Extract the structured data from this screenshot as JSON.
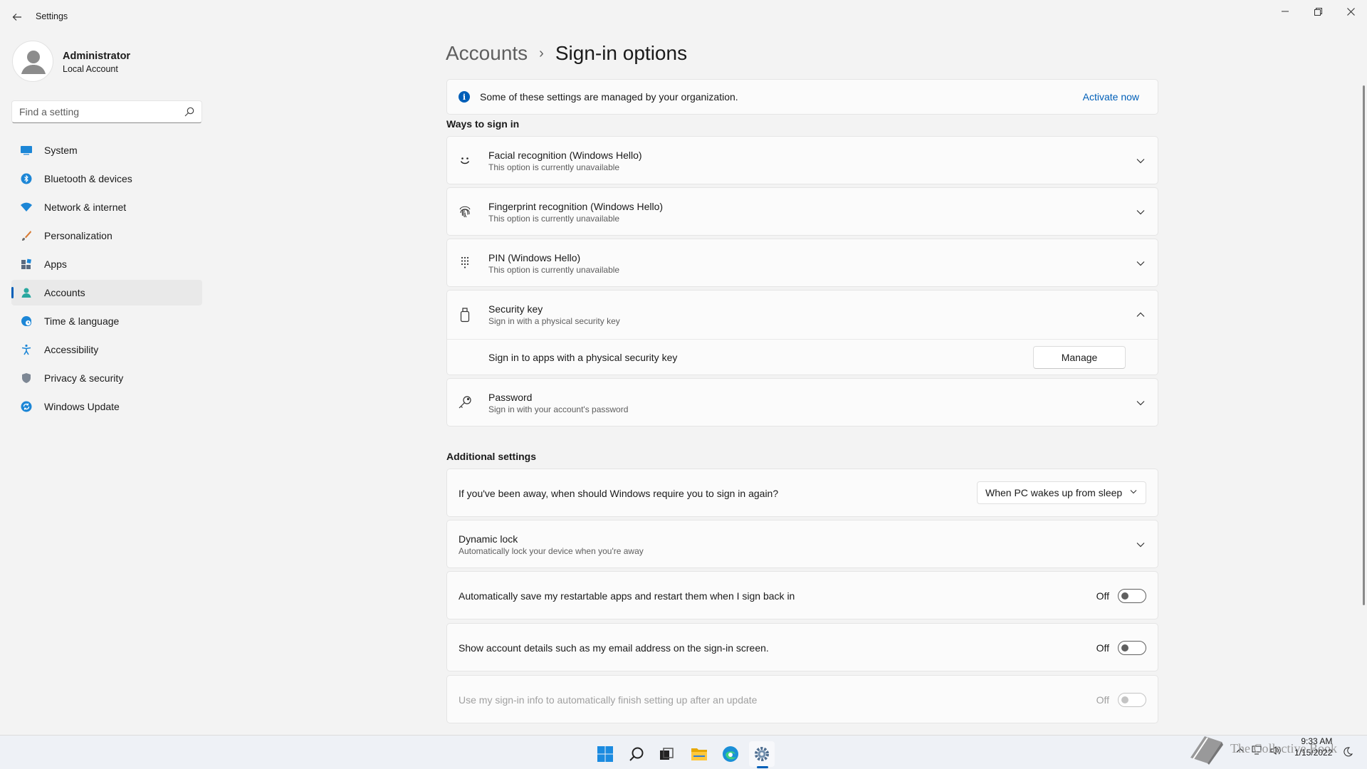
{
  "window": {
    "title": "Settings",
    "controls": {
      "minimize": "─",
      "maximize": "❐",
      "close": "✕"
    }
  },
  "user": {
    "name": "Administrator",
    "account_type": "Local Account"
  },
  "search": {
    "placeholder": "Find a setting"
  },
  "nav": {
    "items": [
      {
        "label": "System",
        "icon": "system-icon",
        "active": false
      },
      {
        "label": "Bluetooth & devices",
        "icon": "bluetooth-icon",
        "active": false
      },
      {
        "label": "Network & internet",
        "icon": "wifi-icon",
        "active": false
      },
      {
        "label": "Personalization",
        "icon": "brush-icon",
        "active": false
      },
      {
        "label": "Apps",
        "icon": "apps-icon",
        "active": false
      },
      {
        "label": "Accounts",
        "icon": "person-icon",
        "active": true
      },
      {
        "label": "Time & language",
        "icon": "globe-clock-icon",
        "active": false
      },
      {
        "label": "Accessibility",
        "icon": "accessibility-icon",
        "active": false
      },
      {
        "label": "Privacy & security",
        "icon": "shield-icon",
        "active": false
      },
      {
        "label": "Windows Update",
        "icon": "update-icon",
        "active": false
      }
    ]
  },
  "breadcrumb": {
    "parent": "Accounts",
    "separator": "›",
    "current": "Sign-in options"
  },
  "notice": {
    "text": "Some of these settings are managed by your organization.",
    "link": "Activate now"
  },
  "ways": {
    "title": "Ways to sign in",
    "items": [
      {
        "title": "Facial recognition (Windows Hello)",
        "subtitle": "This option is currently unavailable",
        "icon": "face-icon",
        "expanded": false
      },
      {
        "title": "Fingerprint recognition (Windows Hello)",
        "subtitle": "This option is currently unavailable",
        "icon": "fingerprint-icon",
        "expanded": false
      },
      {
        "title": "PIN (Windows Hello)",
        "subtitle": "This option is currently unavailable",
        "icon": "pin-keypad-icon",
        "expanded": false
      },
      {
        "title": "Security key",
        "subtitle": "Sign in with a physical security key",
        "icon": "usb-key-icon",
        "expanded": true
      },
      {
        "title": "Password",
        "subtitle": "Sign in with your account's password",
        "icon": "key-icon",
        "expanded": false
      }
    ],
    "security_key_detail": {
      "text": "Sign in to apps with a physical security key",
      "button": "Manage"
    }
  },
  "additional": {
    "title": "Additional settings",
    "require_signin": {
      "text": "If you've been away, when should Windows require you to sign in again?",
      "selected": "When PC wakes up from sleep"
    },
    "dynamic_lock": {
      "title": "Dynamic lock",
      "subtitle": "Automatically lock your device when you're away"
    },
    "toggles": [
      {
        "text": "Automatically save my restartable apps and restart them when I sign back in",
        "state": "Off",
        "enabled": true
      },
      {
        "text": "Show account details such as my email address on the sign-in screen.",
        "state": "Off",
        "enabled": true
      },
      {
        "text": "Use my sign-in info to automatically finish setting up after an update",
        "state": "Off",
        "enabled": false
      }
    ]
  },
  "taskbar": {
    "icons": [
      "windows-start-icon",
      "search-icon",
      "task-view-icon",
      "file-explorer-icon",
      "edge-icon",
      "settings-icon"
    ],
    "clock": {
      "time": "9:33 AM",
      "date": "1/15/2022"
    },
    "watermark": "The Collective Book"
  },
  "colors": {
    "accent": "#005fb8",
    "background": "#f3f3f3",
    "card": "#fbfbfb"
  }
}
